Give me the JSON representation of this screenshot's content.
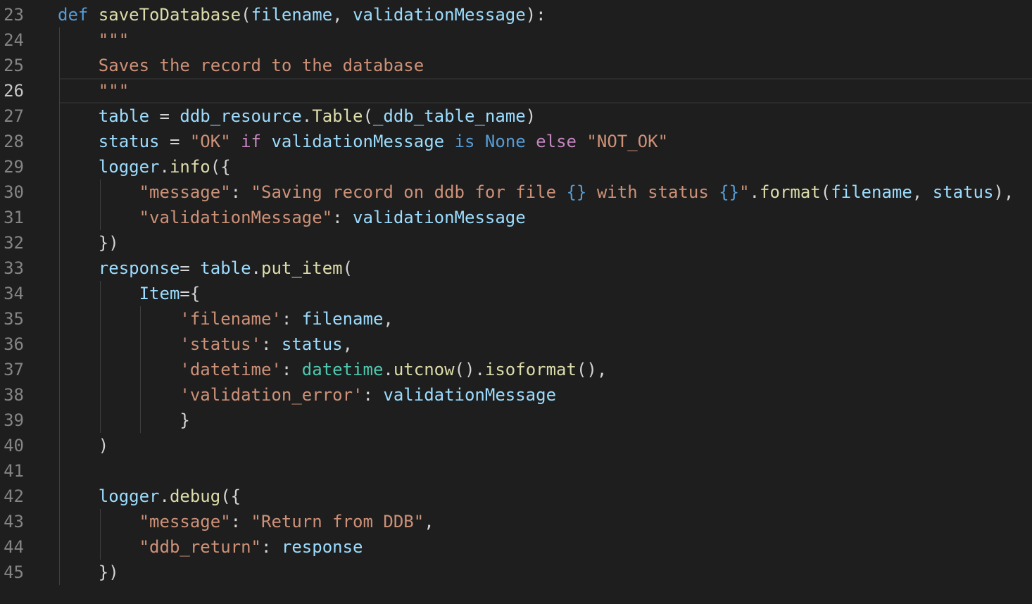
{
  "editor": {
    "language": "python",
    "current_line": 26,
    "colors": {
      "background": "#1e1e1e",
      "keyword": "#569cd6",
      "function": "#dcdcaa",
      "variable": "#9cdcfe",
      "string": "#ce9178",
      "control": "#c586c0",
      "class": "#4ec9b0",
      "line_number": "#858585"
    },
    "lines": [
      {
        "num": "23",
        "tokens": [
          {
            "t": "kw",
            "v": "def"
          },
          {
            "t": "punc",
            "v": " "
          },
          {
            "t": "fn",
            "v": "saveToDatabase"
          },
          {
            "t": "punc",
            "v": "("
          },
          {
            "t": "param",
            "v": "filename"
          },
          {
            "t": "punc",
            "v": ", "
          },
          {
            "t": "param",
            "v": "validationMessage"
          },
          {
            "t": "punc",
            "v": "):"
          }
        ]
      },
      {
        "num": "24",
        "tokens": [
          {
            "t": "punc",
            "v": "    "
          },
          {
            "t": "str",
            "v": "\"\"\""
          }
        ]
      },
      {
        "num": "25",
        "tokens": [
          {
            "t": "punc",
            "v": "    "
          },
          {
            "t": "str",
            "v": "Saves the record to the database"
          }
        ]
      },
      {
        "num": "26",
        "tokens": [
          {
            "t": "punc",
            "v": "    "
          },
          {
            "t": "str",
            "v": "\"\"\""
          }
        ]
      },
      {
        "num": "27",
        "tokens": [
          {
            "t": "punc",
            "v": "    "
          },
          {
            "t": "param",
            "v": "table"
          },
          {
            "t": "punc",
            "v": " = "
          },
          {
            "t": "param",
            "v": "ddb_resource"
          },
          {
            "t": "punc",
            "v": "."
          },
          {
            "t": "fn",
            "v": "Table"
          },
          {
            "t": "punc",
            "v": "("
          },
          {
            "t": "param",
            "v": "_ddb_table_name"
          },
          {
            "t": "punc",
            "v": ")"
          }
        ]
      },
      {
        "num": "28",
        "tokens": [
          {
            "t": "punc",
            "v": "    "
          },
          {
            "t": "param",
            "v": "status"
          },
          {
            "t": "punc",
            "v": " = "
          },
          {
            "t": "str",
            "v": "\"OK\""
          },
          {
            "t": "punc",
            "v": " "
          },
          {
            "t": "ctl",
            "v": "if"
          },
          {
            "t": "punc",
            "v": " "
          },
          {
            "t": "param",
            "v": "validationMessage"
          },
          {
            "t": "punc",
            "v": " "
          },
          {
            "t": "kw",
            "v": "is"
          },
          {
            "t": "punc",
            "v": " "
          },
          {
            "t": "const",
            "v": "None"
          },
          {
            "t": "punc",
            "v": " "
          },
          {
            "t": "ctl",
            "v": "else"
          },
          {
            "t": "punc",
            "v": " "
          },
          {
            "t": "str",
            "v": "\"NOT_OK\""
          }
        ]
      },
      {
        "num": "29",
        "tokens": [
          {
            "t": "punc",
            "v": "    "
          },
          {
            "t": "param",
            "v": "logger"
          },
          {
            "t": "punc",
            "v": "."
          },
          {
            "t": "fn",
            "v": "info"
          },
          {
            "t": "punc",
            "v": "({"
          }
        ]
      },
      {
        "num": "30",
        "tokens": [
          {
            "t": "punc",
            "v": "        "
          },
          {
            "t": "str",
            "v": "\"message\""
          },
          {
            "t": "punc",
            "v": ": "
          },
          {
            "t": "str",
            "v": "\"Saving record on ddb for file "
          },
          {
            "t": "esc",
            "v": "{}"
          },
          {
            "t": "str",
            "v": " with status "
          },
          {
            "t": "esc",
            "v": "{}"
          },
          {
            "t": "str",
            "v": "\""
          },
          {
            "t": "punc",
            "v": "."
          },
          {
            "t": "fn",
            "v": "format"
          },
          {
            "t": "punc",
            "v": "("
          },
          {
            "t": "param",
            "v": "filename"
          },
          {
            "t": "punc",
            "v": ", "
          },
          {
            "t": "param",
            "v": "status"
          },
          {
            "t": "punc",
            "v": "),"
          }
        ]
      },
      {
        "num": "31",
        "tokens": [
          {
            "t": "punc",
            "v": "        "
          },
          {
            "t": "str",
            "v": "\"validationMessage\""
          },
          {
            "t": "punc",
            "v": ": "
          },
          {
            "t": "param",
            "v": "validationMessage"
          }
        ]
      },
      {
        "num": "32",
        "tokens": [
          {
            "t": "punc",
            "v": "    })"
          }
        ]
      },
      {
        "num": "33",
        "tokens": [
          {
            "t": "punc",
            "v": "    "
          },
          {
            "t": "param",
            "v": "response"
          },
          {
            "t": "punc",
            "v": "= "
          },
          {
            "t": "param",
            "v": "table"
          },
          {
            "t": "punc",
            "v": "."
          },
          {
            "t": "fn",
            "v": "put_item"
          },
          {
            "t": "punc",
            "v": "("
          }
        ]
      },
      {
        "num": "34",
        "tokens": [
          {
            "t": "punc",
            "v": "        "
          },
          {
            "t": "param",
            "v": "Item"
          },
          {
            "t": "punc",
            "v": "={"
          }
        ]
      },
      {
        "num": "35",
        "tokens": [
          {
            "t": "punc",
            "v": "            "
          },
          {
            "t": "str",
            "v": "'filename'"
          },
          {
            "t": "punc",
            "v": ": "
          },
          {
            "t": "param",
            "v": "filename"
          },
          {
            "t": "punc",
            "v": ","
          }
        ]
      },
      {
        "num": "36",
        "tokens": [
          {
            "t": "punc",
            "v": "            "
          },
          {
            "t": "str",
            "v": "'status'"
          },
          {
            "t": "punc",
            "v": ": "
          },
          {
            "t": "param",
            "v": "status"
          },
          {
            "t": "punc",
            "v": ","
          }
        ]
      },
      {
        "num": "37",
        "tokens": [
          {
            "t": "punc",
            "v": "            "
          },
          {
            "t": "str",
            "v": "'datetime'"
          },
          {
            "t": "punc",
            "v": ": "
          },
          {
            "t": "cls",
            "v": "datetime"
          },
          {
            "t": "punc",
            "v": "."
          },
          {
            "t": "fn",
            "v": "utcnow"
          },
          {
            "t": "punc",
            "v": "()."
          },
          {
            "t": "fn",
            "v": "isoformat"
          },
          {
            "t": "punc",
            "v": "(),"
          }
        ]
      },
      {
        "num": "38",
        "tokens": [
          {
            "t": "punc",
            "v": "            "
          },
          {
            "t": "str",
            "v": "'validation_error'"
          },
          {
            "t": "punc",
            "v": ": "
          },
          {
            "t": "param",
            "v": "validationMessage"
          }
        ]
      },
      {
        "num": "39",
        "tokens": [
          {
            "t": "punc",
            "v": "            }"
          }
        ]
      },
      {
        "num": "40",
        "tokens": [
          {
            "t": "punc",
            "v": "    )"
          }
        ]
      },
      {
        "num": "41",
        "tokens": []
      },
      {
        "num": "42",
        "tokens": [
          {
            "t": "punc",
            "v": "    "
          },
          {
            "t": "param",
            "v": "logger"
          },
          {
            "t": "punc",
            "v": "."
          },
          {
            "t": "fn",
            "v": "debug"
          },
          {
            "t": "punc",
            "v": "({"
          }
        ]
      },
      {
        "num": "43",
        "tokens": [
          {
            "t": "punc",
            "v": "        "
          },
          {
            "t": "str",
            "v": "\"message\""
          },
          {
            "t": "punc",
            "v": ": "
          },
          {
            "t": "str",
            "v": "\"Return from DDB\""
          },
          {
            "t": "punc",
            "v": ","
          }
        ]
      },
      {
        "num": "44",
        "tokens": [
          {
            "t": "punc",
            "v": "        "
          },
          {
            "t": "str",
            "v": "\"ddb_return\""
          },
          {
            "t": "punc",
            "v": ": "
          },
          {
            "t": "param",
            "v": "response"
          }
        ]
      },
      {
        "num": "45",
        "tokens": [
          {
            "t": "punc",
            "v": "    })"
          }
        ]
      }
    ]
  }
}
